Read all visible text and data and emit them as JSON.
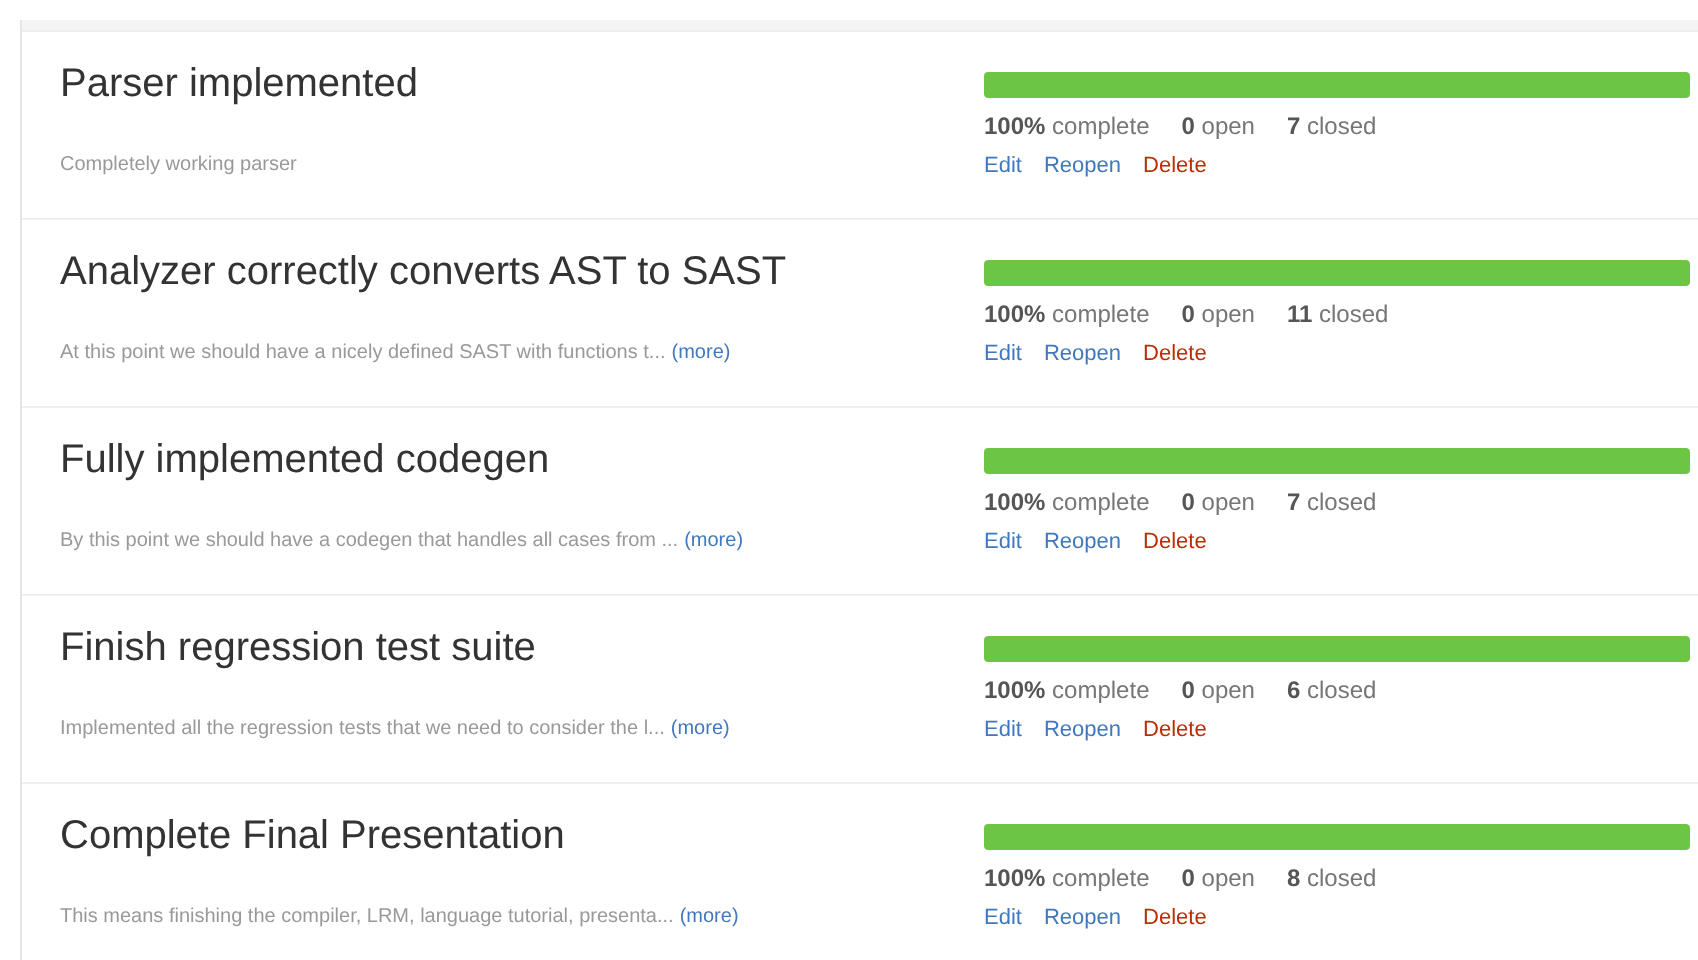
{
  "milestones": [
    {
      "title": "Parser implemented",
      "description": "Completely working parser",
      "level": 1,
      "percent": "100%",
      "complete_label": "complete",
      "open_count": "0",
      "open_label": "open",
      "closed_count": "7",
      "closed_label": "closed",
      "actions": [
        {
          "label": "Edit",
          "kind": "edit"
        },
        {
          "label": "Reopen",
          "kind": "reopen"
        },
        {
          "label": "Delete",
          "kind": "delete"
        }
      ]
    },
    {
      "title": "Analyzer correctly converts AST to SAST",
      "description": "At this point we should have a nicely defined SAST with functions t...",
      "more": "(more)",
      "level": 1,
      "percent": "100%",
      "complete_label": "complete",
      "open_count": "0",
      "open_label": "open",
      "closed_count": "11",
      "closed_label": "closed",
      "actions": [
        {
          "label": "Edit",
          "kind": "edit"
        },
        {
          "label": "Reopen",
          "kind": "reopen"
        },
        {
          "label": "Delete",
          "kind": "delete"
        }
      ]
    },
    {
      "title": "Fully implemented codegen",
      "description": "By this point we should have a codegen that handles all cases from ...",
      "more": "(more)",
      "level": 1,
      "percent": "100%",
      "complete_label": "complete",
      "open_count": "0",
      "open_label": "open",
      "closed_count": "7",
      "closed_label": "closed",
      "actions": [
        {
          "label": "Edit",
          "kind": "edit"
        },
        {
          "label": "Reopen",
          "kind": "reopen"
        },
        {
          "label": "Delete",
          "kind": "delete"
        }
      ]
    },
    {
      "title": "Finish regression test suite",
      "description": "Implemented all the regression tests that we need to consider the l...",
      "more": "(more)",
      "level": 1,
      "percent": "100%",
      "complete_label": "complete",
      "open_count": "0",
      "open_label": "open",
      "closed_count": "6",
      "closed_label": "closed",
      "actions": [
        {
          "label": "Edit",
          "kind": "edit"
        },
        {
          "label": "Reopen",
          "kind": "reopen"
        },
        {
          "label": "Delete",
          "kind": "delete"
        }
      ]
    },
    {
      "title": "Complete Final Presentation",
      "description": "This means finishing the compiler, LRM, language tutorial, presenta...",
      "more": "(more)",
      "level": 1,
      "percent": "100%",
      "complete_label": "complete",
      "open_count": "0",
      "open_label": "open",
      "closed_count": "8",
      "closed_label": "closed",
      "actions": [
        {
          "label": "Edit",
          "kind": "edit"
        },
        {
          "label": "Reopen",
          "kind": "reopen"
        },
        {
          "label": "Delete",
          "kind": "delete"
        }
      ]
    }
  ]
}
